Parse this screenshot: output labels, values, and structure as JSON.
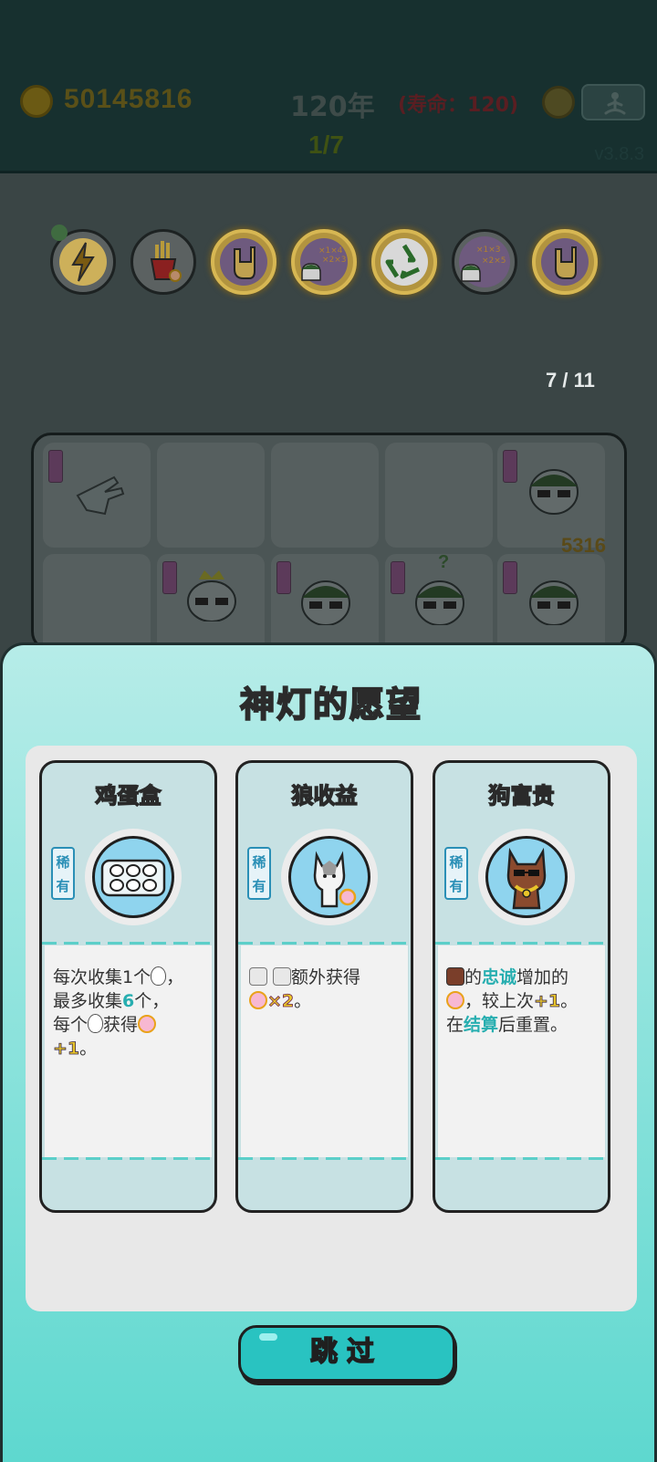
{
  "header": {
    "coins": "50145816",
    "year": "120年",
    "lifespan": "(寿命：120)",
    "round": "1/7",
    "version": "v3.8.3"
  },
  "relics": [
    {
      "icon": "lightning-icon",
      "style": "plain"
    },
    {
      "icon": "fries-icon",
      "style": "plain"
    },
    {
      "icon": "rock-hand-icon",
      "style": "gold"
    },
    {
      "icon": "math-head-icon",
      "style": "gold"
    },
    {
      "icon": "recycle-icon",
      "style": "gold"
    },
    {
      "icon": "math-head-icon",
      "style": "plain"
    },
    {
      "icon": "rock-hand-icon",
      "style": "gold"
    }
  ],
  "progress": "7 / 11",
  "board": {
    "number": "5316",
    "question": "?"
  },
  "modal": {
    "title": "神灯的愿望",
    "skip_label": "跳过",
    "cards": [
      {
        "title": "鸡蛋盒",
        "rarity": "稀有",
        "icon": "egg-carton-icon",
        "desc": {
          "l1a": "每次收集1个",
          "l1b": "，",
          "l2a": "最多收集",
          "l2b": "6",
          "l2c": "个，",
          "l3a": "每个",
          "l3b": "获得",
          "l4a": "+1",
          "l4b": "。"
        }
      },
      {
        "title": "狼收益",
        "rarity": "稀有",
        "icon": "wolf-icon",
        "desc": {
          "l1a": "额外获得",
          "l2a": "×2",
          "l2b": "。"
        }
      },
      {
        "title": "狗富贵",
        "rarity": "稀有",
        "icon": "rich-dog-icon",
        "desc": {
          "l1a": "的",
          "l1b": "忠诚",
          "l1c": "增加的",
          "l2a": "，较上次",
          "l2b": "+1",
          "l2c": "。",
          "l3a": "在",
          "l3b": "结算",
          "l3c": "后重置。"
        }
      }
    ]
  },
  "colors": {
    "accent": "#29c3c1",
    "title_yellow": "#f7d63b",
    "rarity_blue": "#2a8fb6",
    "highlight_cyan": "#27aeb0"
  }
}
